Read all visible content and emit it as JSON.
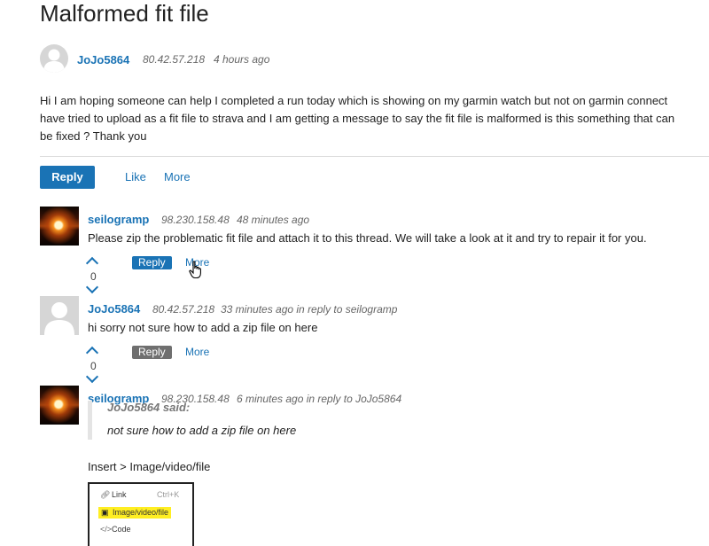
{
  "thread": {
    "title": "Malformed fit file"
  },
  "post": {
    "username": "JoJo5864",
    "ip": "80.42.57.218",
    "time": "4 hours ago",
    "body_lines": [
      "Hi I am hoping someone can help I completed a run today which is showing on my garmin watch but not on garmin connect",
      "have tried to upload as a fit file to strava and I am getting a message to say the fit file is malformed is this something that can",
      "be fixed ? Thank you"
    ],
    "reply_label": "Reply",
    "like_label": "Like",
    "more_label": "More"
  },
  "replies": [
    {
      "username": "seilogramp",
      "ip": "98.230.158.48",
      "time": "48 minutes ago",
      "text": "Please zip the problematic fit file and attach it to this thread. We will take a look at it and try to repair it for you.",
      "votes": "0",
      "reply_label": "Reply",
      "more_label": "More"
    },
    {
      "username": "JoJo5864",
      "ip": "80.42.57.218",
      "time": "33 minutes ago in reply to seilogramp",
      "text": "hi sorry not sure how to add a zip file on here",
      "votes": "0",
      "reply_label": "Reply",
      "more_label": "More"
    },
    {
      "username": "seilogramp",
      "ip": "98.230.158.48",
      "time": "6 minutes ago in reply to JoJo5864",
      "quote_author": "JoJo5864 said:",
      "quote_text": "not sure how to add a zip file on here",
      "text": "Insert > Image/video/file",
      "menu": {
        "items": [
          {
            "label": "Link",
            "icon": "link-icon",
            "shortcut": "Ctrl+K"
          },
          {
            "label": "Image/video/file",
            "icon": "image-icon",
            "highlighted": true
          },
          {
            "label": "Code",
            "icon": "code-icon"
          }
        ]
      }
    }
  ],
  "colors": {
    "accent": "#1a73b5",
    "highlight": "#ffee22",
    "chip_idle": "#6f6f6f"
  }
}
